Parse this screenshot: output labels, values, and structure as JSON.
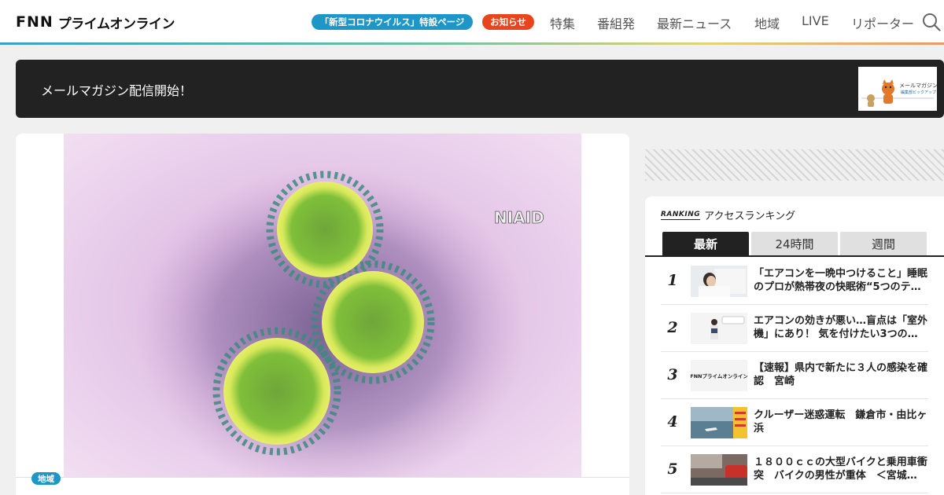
{
  "header": {
    "logo_fnn": "FNN",
    "logo_text": "プライムオンライン",
    "covid_pill": "「新型コロナウイルス」特設ページ",
    "notice_pill": "お知らせ",
    "nav": [
      "特集",
      "番組発",
      "最新ニュース",
      "地域",
      "LIVE",
      "リポーター"
    ]
  },
  "banner": {
    "text": "メールマガジン配信開始！",
    "thumb_caption_1": "メールマガジン",
    "thumb_caption_2": "編集部ピックアップ"
  },
  "article": {
    "image_watermark": "NIAID",
    "region_badge": "地域"
  },
  "ranking": {
    "label_en": "RANKING",
    "title": "アクセスランキング",
    "tabs": [
      "最新",
      "24時間",
      "週間"
    ],
    "active_tab": 0,
    "items": [
      {
        "rank": "1",
        "title": "「エアコンを一晩中つけること」睡眠のプロが熱帯夜の快眠術“5つのテ…"
      },
      {
        "rank": "2",
        "title": "エアコンの効きが悪い…盲点は「室外機」にあり！ 気を付けたい3つの…"
      },
      {
        "rank": "3",
        "title": "【速報】県内で新たに３人の感染を確認　宮崎",
        "thumb_logo": "FNNプライムオンライン"
      },
      {
        "rank": "4",
        "title": "クルーザー迷惑運転　鎌倉市・由比ヶ浜"
      },
      {
        "rank": "5",
        "title": "１８００ｃｃの大型バイクと乗用車衝突　バイクの男性が重体　＜宮城…"
      }
    ]
  },
  "colors": {
    "accent_blue": "#1e96c8",
    "notice_red": "#e8441e",
    "dark": "#222222"
  }
}
